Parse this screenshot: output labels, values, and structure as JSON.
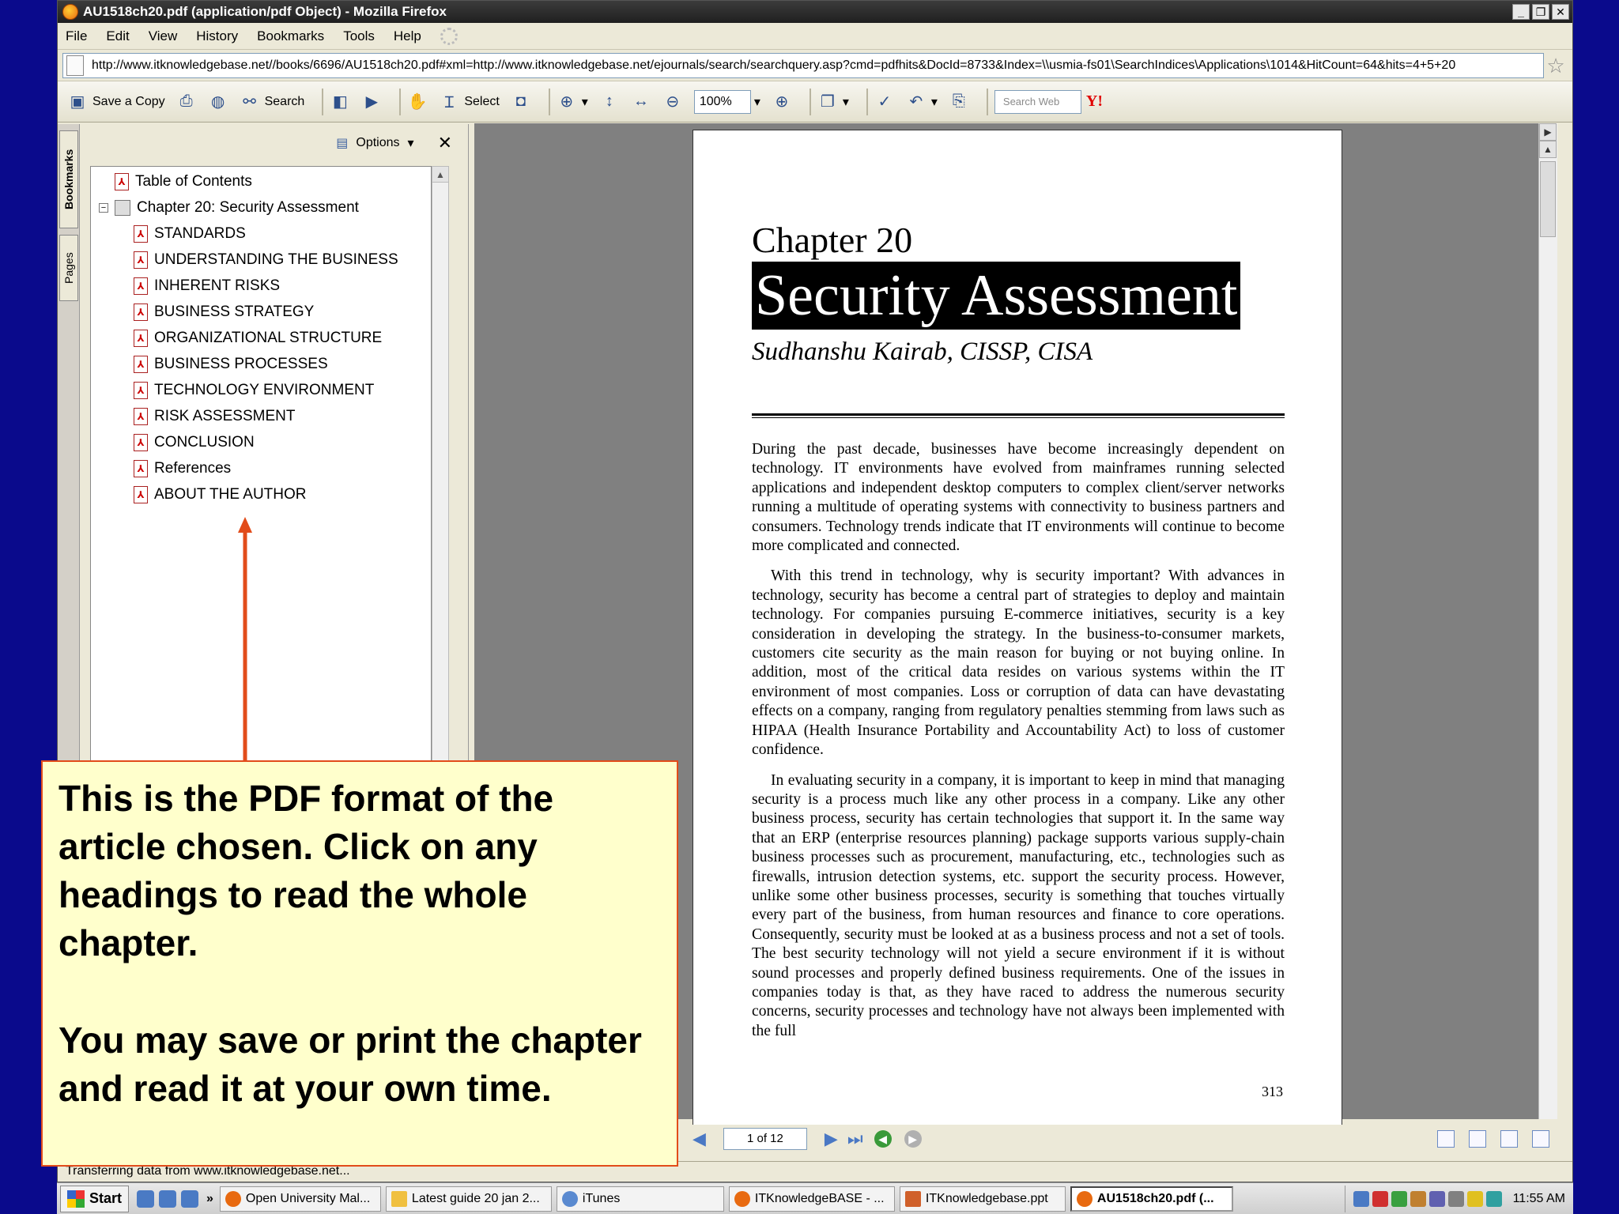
{
  "window": {
    "title": "AU1518ch20.pdf (application/pdf Object) - Mozilla Firefox",
    "controls": [
      "_",
      "❐",
      "✕"
    ]
  },
  "menu": [
    "File",
    "Edit",
    "View",
    "History",
    "Bookmarks",
    "Tools",
    "Help"
  ],
  "url": "http://www.itknowledgebase.net//books/6696/AU1518ch20.pdf#xml=http://www.itknowledgebase.net/ejournals/search/searchquery.asp?cmd=pdfhits&DocId=8733&Index=\\\\usmia-fs01\\SearchIndices\\Applications\\1014&HitCount=64&hits=4+5+20",
  "toolbar": {
    "save_copy": "Save a Copy",
    "search": "Search",
    "select": "Select",
    "zoom": "100%",
    "search_web_placeholder": "Search Web",
    "yahoo": "Y!"
  },
  "nav_tabs": {
    "bookmarks": "Bookmarks",
    "pages": "Pages"
  },
  "bookmarks": {
    "options": "Options",
    "close": "✕",
    "toc": "Table of Contents",
    "chapter": "Chapter 20: Security Assessment",
    "items": [
      "STANDARDS",
      "UNDERSTANDING THE BUSINESS",
      "INHERENT RISKS",
      "BUSINESS STRATEGY",
      "ORGANIZATIONAL STRUCTURE",
      "BUSINESS PROCESSES",
      "TECHNOLOGY ENVIRONMENT",
      "RISK ASSESSMENT",
      "CONCLUSION",
      "References",
      "ABOUT THE AUTHOR"
    ]
  },
  "document": {
    "chapter_number": "Chapter 20",
    "chapter_title": "Security Assessment",
    "author": "Sudhanshu Kairab, CISSP, CISA",
    "paragraphs": [
      "During the past decade, businesses have become increasingly dependent on technology. IT environments have evolved from mainframes running selected applications and independent desktop computers to complex client/server networks running a multitude of operating systems with connectivity to business partners and consumers. Technology trends indicate that IT environments will continue to become more complicated and connected.",
      "With this trend in technology, why is security important? With advances in technology, security has become a central part of strategies to deploy and maintain technology. For companies pursuing E-commerce initiatives, security is a key consideration in developing the strategy. In the business-to-consumer markets, customers cite security as the main reason for buying or not buying online. In addition, most of the critical data resides on various systems within the IT environment of most companies. Loss or corruption of data can have devastating effects on a company, ranging from regulatory penalties stemming from laws such as HIPAA (Health Insurance Portability and Accountability Act) to loss of customer confidence.",
      "In evaluating security in a company, it is important to keep in mind that managing security is a process much like any other process in a company. Like any other business process, security has certain technologies that support it. In the same way that an ERP (enterprise resources planning) package supports various supply-chain business processes such as procurement, manufacturing, etc., technologies such as firewalls, intrusion detection systems, etc. support the security process. However, unlike some other business processes, security is something that touches virtually every part of the business, from human resources and finance to core operations. Consequently, security must be looked at as a business process and not a set of tools. The best security technology will not yield a secure environment if it is without sound processes and properly defined business requirements. One of the issues in companies today is that, as they have raced to address the numerous security concerns, security processes and technology have not always been implemented with the full"
    ],
    "page_number": "313"
  },
  "pdf_status": {
    "page_indicator": "1 of 12"
  },
  "ff_status": "Transferring data from www.itknowledgebase.net...",
  "taskbar": {
    "start": "Start",
    "tasks": [
      "Open University Mal...",
      "Latest guide 20 jan 2...",
      "iTunes",
      "ITKnowledgeBASE - ...",
      "ITKnowledgebase.ppt",
      "AU1518ch20.pdf (..."
    ],
    "clock": "11:55 AM"
  },
  "callout": {
    "line1": "This is the PDF format of the article chosen. Click on any headings to read the whole chapter.",
    "line2": "You may save or print the chapter and read it at your own time."
  },
  "colors": {
    "background": "#0a0a8c",
    "callout_bg": "#ffffcc",
    "callout_border": "#e24c1a",
    "arrow": "#e24c1a"
  }
}
